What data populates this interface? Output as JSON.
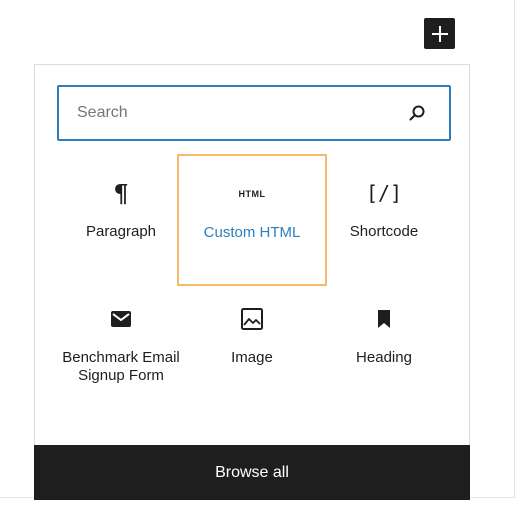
{
  "toolbar": {
    "add_block_icon": "plus-icon"
  },
  "inserter": {
    "search": {
      "placeholder": "Search",
      "value": "",
      "icon": "search-icon"
    },
    "blocks": [
      {
        "label": "Paragraph",
        "icon": "paragraph-icon",
        "selected": false
      },
      {
        "label": "Custom HTML",
        "icon": "html-icon",
        "icon_text": "HTML",
        "selected": true
      },
      {
        "label": "Shortcode",
        "icon": "shortcode-icon",
        "icon_text": "[/]",
        "selected": false
      },
      {
        "label": "Benchmark Email Signup Form",
        "icon": "envelope-icon",
        "selected": false
      },
      {
        "label": "Image",
        "icon": "image-icon",
        "selected": false
      },
      {
        "label": "Heading",
        "icon": "bookmark-icon",
        "selected": false
      }
    ],
    "browse_all_label": "Browse all"
  },
  "colors": {
    "accent": "#2b7fbe",
    "highlight": "#f6b96b",
    "dark": "#1e1e1e"
  }
}
